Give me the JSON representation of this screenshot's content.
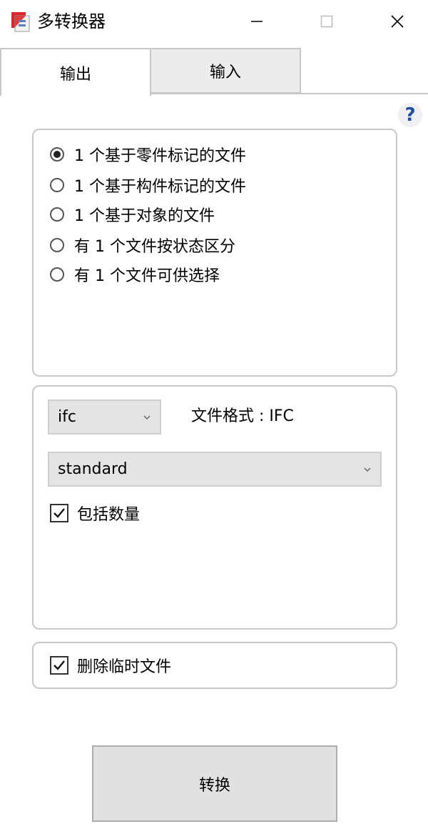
{
  "window": {
    "title": "多转换器",
    "icon": "multi-converter-app-icon",
    "controls": [
      "minimize-icon",
      "maximize-icon",
      "close-icon"
    ]
  },
  "tabs": [
    {
      "label": "输出",
      "active": true
    },
    {
      "label": "输入",
      "active": false
    }
  ],
  "help": {
    "label": "?",
    "color": "#1f4ea0"
  },
  "output_options": [
    {
      "label": "1 个基于零件标记的文件",
      "checked": true
    },
    {
      "label": "1 个基于构件标记的文件",
      "checked": false
    },
    {
      "label": "1 个基于对象的文件",
      "checked": false
    },
    {
      "label": "有 1 个文件按状态区分",
      "checked": false
    },
    {
      "label": "有 1 个文件可供选择",
      "checked": false
    }
  ],
  "format": {
    "selected": "ifc",
    "format_label": "文件格式 : IFC",
    "profile": "standard",
    "include_quantities_label": "包括数量",
    "include_quantities_checked": true
  },
  "temp": {
    "delete_temp_label": "删除临时文件",
    "delete_temp_checked": true
  },
  "actions": {
    "convert_label": "转换"
  }
}
